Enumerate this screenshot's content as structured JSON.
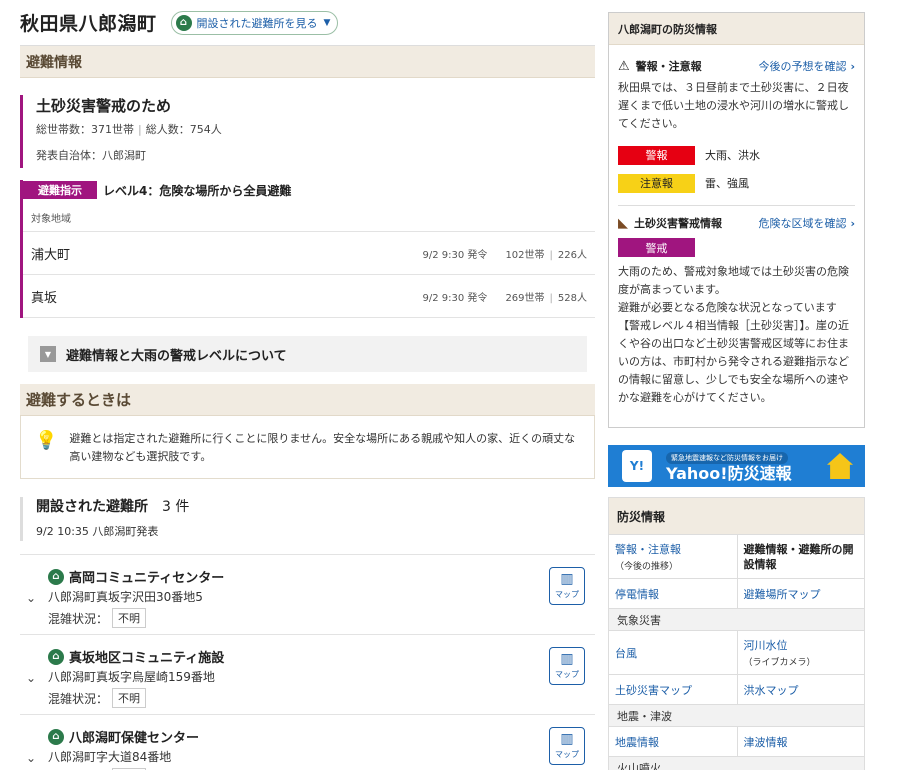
{
  "header": {
    "title": "秋田県八郎潟町",
    "open_shelter_button": "開設された避難所を見る"
  },
  "evac_info": {
    "section_title": "避難情報",
    "reason": "土砂災害警戒のため",
    "households": "総世帯数：371世帯",
    "people": "総人数：754人",
    "issuer": "発表自治体：八郎潟町",
    "badge": "避難指示",
    "level": "レベル4：危険な場所から全員避難",
    "area_header": "対象地域",
    "areas": [
      {
        "name": "浦大町",
        "issued": "9/2 9:30 発令",
        "households": "102世帯",
        "people": "226人"
      },
      {
        "name": "真坂",
        "issued": "9/2 9:30 発令",
        "households": "269世帯",
        "people": "528人"
      }
    ],
    "accordion": "避難情報と大雨の警戒レベルについて"
  },
  "evac_when": {
    "section_title": "避難するときは",
    "note": "避難とは指定された避難所に行くことに限りません。安全な場所にある親戚や知人の家、近くの頑丈な高い建物なども選択肢です。"
  },
  "shelters": {
    "title": "開設された避難所",
    "count": "3 件",
    "updated": "9/2 10:35 八郎潟町発表",
    "crowd_label": "混雑状況：",
    "map_label": "マップ",
    "items": [
      {
        "name": "高岡コミュニティセンター",
        "address": "八郎潟町真坂字沢田30番地5",
        "crowd": "不明"
      },
      {
        "name": "真坂地区コミュニティ施設",
        "address": "八郎潟町真坂字烏屋崎159番地",
        "crowd": "不明"
      },
      {
        "name": "八郎潟町保健センター",
        "address": "八郎潟町字大道84番地",
        "crowd": "不明"
      }
    ]
  },
  "sidebar": {
    "box_title": "八郎潟町の防災情報",
    "warning": {
      "label": "警報・注意報",
      "link": "今後の予想を確認",
      "text": "秋田県では、３日昼前まで土砂災害に、２日夜遅くまで低い土地の浸水や河川の増水に警戒してください。",
      "rows": [
        {
          "badge": "警報",
          "text": "大雨、洪水",
          "bg": "#e60012",
          "fg": "#ffffff"
        },
        {
          "badge": "注意報",
          "text": "雷、強風",
          "bg": "#f7d117",
          "fg": "#222222"
        }
      ]
    },
    "landslide": {
      "label": "土砂災害警戒情報",
      "link": "危険な区域を確認",
      "badge": "警戒",
      "text1": "大雨のため、警戒対象地域では土砂災害の危険度が高まっています。",
      "text2": "避難が必要となる危険な状況となっています【警戒レベル４相当情報［土砂災害］】。崖の近くや谷の出口など土砂災害警戒区域等にお住まいの方は、市町村から発令される避難指示などの情報に留意し、少しでも安全な場所への速やかな避難を心がけてください。"
    },
    "banner": {
      "small": "緊急地震速報など防災情報をお届け",
      "big": "Yahoo!防災速報",
      "phone": "Y!"
    },
    "bosai": {
      "title": "防災情報",
      "row1": {
        "left": "警報・注意報",
        "left_small": "（今後の推移）",
        "right": "避難情報・避難所の開設情報"
      },
      "row2": {
        "left": "停電情報",
        "right": "避難場所マップ"
      },
      "cat1": "気象災害",
      "row3": {
        "left": "台風",
        "right": "河川水位",
        "right_small": "（ライブカメラ）"
      },
      "row4": {
        "left": "土砂災害マップ",
        "right": "洪水マップ"
      },
      "cat2": "地震・津波",
      "row5": {
        "left": "地震情報",
        "right": "津波情報"
      },
      "cat3": "火山噴火"
    }
  }
}
